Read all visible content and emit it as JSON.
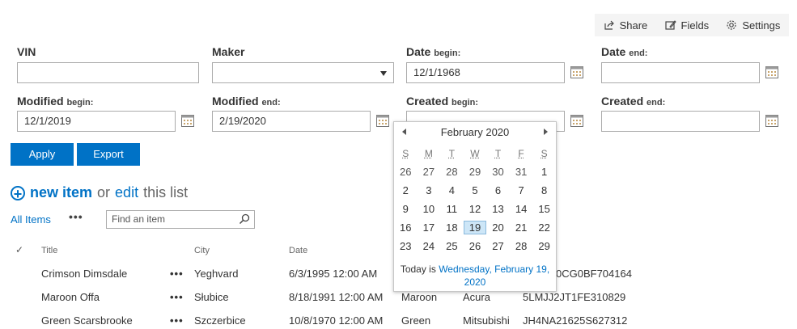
{
  "toolbar": {
    "share": "Share",
    "fields": "Fields",
    "settings": "Settings"
  },
  "filters": {
    "vin": {
      "label": "VIN",
      "value": ""
    },
    "maker": {
      "label": "Maker",
      "value": ""
    },
    "date_begin": {
      "label": "Date",
      "sub": "begin:",
      "value": "12/1/1968"
    },
    "date_end": {
      "label": "Date",
      "sub": "end:",
      "value": ""
    },
    "modified_begin": {
      "label": "Modified",
      "sub": "begin:",
      "value": "12/1/2019"
    },
    "modified_end": {
      "label": "Modified",
      "sub": "end:",
      "value": "2/19/2020"
    },
    "created_begin": {
      "label": "Created",
      "sub": "begin:",
      "value": ""
    },
    "created_end": {
      "label": "Created",
      "sub": "end:",
      "value": ""
    }
  },
  "actions": {
    "apply": "Apply",
    "export": "Export"
  },
  "list": {
    "new_item": "new item",
    "or": "or",
    "edit": "edit",
    "this_list": "this list",
    "view": "All Items",
    "view_more": "•••",
    "search_placeholder": "Find an item",
    "columns": {
      "check": "✓",
      "title": "Title",
      "city": "City",
      "date": "Date"
    },
    "rows": [
      {
        "title": "Crimson Dimsdale",
        "more": "•••",
        "city": "Yeghvard",
        "date": "6/3/1995 12:00 AM",
        "color": "",
        "maker": "",
        "vin": "0CG0BF704164"
      },
      {
        "title": "Maroon Offa",
        "more": "•••",
        "city": "Słubice",
        "date": "8/18/1991 12:00 AM",
        "color": "Maroon",
        "maker": "Acura",
        "vin": "5LMJJ2JT1FE310829"
      },
      {
        "title": "Green Scarsbrooke",
        "more": "•••",
        "city": "Szczerbice",
        "date": "10/8/1970 12:00 AM",
        "color": "Green",
        "maker": "Mitsubishi",
        "vin": "JH4NA21625S627312"
      }
    ]
  },
  "calendar": {
    "month_label": "February 2020",
    "weekdays": [
      "S",
      "M",
      "T",
      "W",
      "T",
      "F",
      "S"
    ],
    "weeks": [
      [
        26,
        27,
        28,
        29,
        30,
        31,
        1
      ],
      [
        2,
        3,
        4,
        5,
        6,
        7,
        8
      ],
      [
        9,
        10,
        11,
        12,
        13,
        14,
        15
      ],
      [
        16,
        17,
        18,
        19,
        20,
        21,
        22
      ],
      [
        23,
        24,
        25,
        26,
        27,
        28,
        29
      ]
    ],
    "selected_day": 19,
    "today_prefix": "Today is ",
    "today_link": "Wednesday, February 19, 2020"
  },
  "colors": {
    "accent": "#0072c6",
    "toolbar_bg": "#f4f4f4",
    "selected_day_bg": "#cde6f7"
  }
}
